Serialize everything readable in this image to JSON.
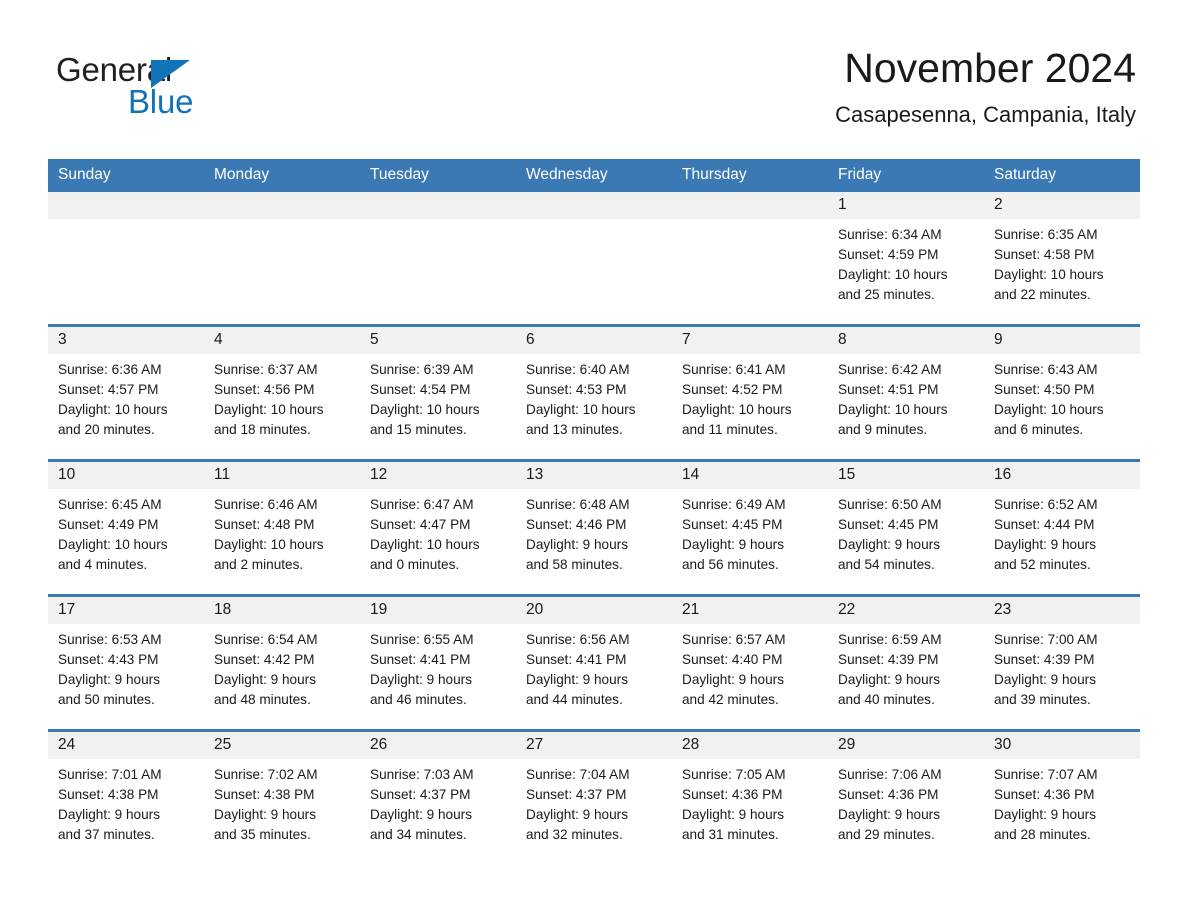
{
  "brand": {
    "name_part1": "General",
    "name_part2": "Blue",
    "accent_color": "#1273b8",
    "logo_icon": "triangle-flag-icon"
  },
  "header": {
    "month_title": "November 2024",
    "location": "Casapesenna, Campania, Italy"
  },
  "calendar": {
    "header_bg": "#3b79b4",
    "daynum_bg": "#f1f1f1",
    "weekdays": [
      "Sunday",
      "Monday",
      "Tuesday",
      "Wednesday",
      "Thursday",
      "Friday",
      "Saturday"
    ],
    "weeks": [
      [
        {
          "day": "",
          "sunrise": "",
          "sunset": "",
          "daylight_line1": "",
          "daylight_line2": "",
          "empty": true
        },
        {
          "day": "",
          "sunrise": "",
          "sunset": "",
          "daylight_line1": "",
          "daylight_line2": "",
          "empty": true
        },
        {
          "day": "",
          "sunrise": "",
          "sunset": "",
          "daylight_line1": "",
          "daylight_line2": "",
          "empty": true
        },
        {
          "day": "",
          "sunrise": "",
          "sunset": "",
          "daylight_line1": "",
          "daylight_line2": "",
          "empty": true
        },
        {
          "day": "",
          "sunrise": "",
          "sunset": "",
          "daylight_line1": "",
          "daylight_line2": "",
          "empty": true
        },
        {
          "day": "1",
          "sunrise": "Sunrise: 6:34 AM",
          "sunset": "Sunset: 4:59 PM",
          "daylight_line1": "Daylight: 10 hours",
          "daylight_line2": "and 25 minutes."
        },
        {
          "day": "2",
          "sunrise": "Sunrise: 6:35 AM",
          "sunset": "Sunset: 4:58 PM",
          "daylight_line1": "Daylight: 10 hours",
          "daylight_line2": "and 22 minutes."
        }
      ],
      [
        {
          "day": "3",
          "sunrise": "Sunrise: 6:36 AM",
          "sunset": "Sunset: 4:57 PM",
          "daylight_line1": "Daylight: 10 hours",
          "daylight_line2": "and 20 minutes."
        },
        {
          "day": "4",
          "sunrise": "Sunrise: 6:37 AM",
          "sunset": "Sunset: 4:56 PM",
          "daylight_line1": "Daylight: 10 hours",
          "daylight_line2": "and 18 minutes."
        },
        {
          "day": "5",
          "sunrise": "Sunrise: 6:39 AM",
          "sunset": "Sunset: 4:54 PM",
          "daylight_line1": "Daylight: 10 hours",
          "daylight_line2": "and 15 minutes."
        },
        {
          "day": "6",
          "sunrise": "Sunrise: 6:40 AM",
          "sunset": "Sunset: 4:53 PM",
          "daylight_line1": "Daylight: 10 hours",
          "daylight_line2": "and 13 minutes."
        },
        {
          "day": "7",
          "sunrise": "Sunrise: 6:41 AM",
          "sunset": "Sunset: 4:52 PM",
          "daylight_line1": "Daylight: 10 hours",
          "daylight_line2": "and 11 minutes."
        },
        {
          "day": "8",
          "sunrise": "Sunrise: 6:42 AM",
          "sunset": "Sunset: 4:51 PM",
          "daylight_line1": "Daylight: 10 hours",
          "daylight_line2": "and 9 minutes."
        },
        {
          "day": "9",
          "sunrise": "Sunrise: 6:43 AM",
          "sunset": "Sunset: 4:50 PM",
          "daylight_line1": "Daylight: 10 hours",
          "daylight_line2": "and 6 minutes."
        }
      ],
      [
        {
          "day": "10",
          "sunrise": "Sunrise: 6:45 AM",
          "sunset": "Sunset: 4:49 PM",
          "daylight_line1": "Daylight: 10 hours",
          "daylight_line2": "and 4 minutes."
        },
        {
          "day": "11",
          "sunrise": "Sunrise: 6:46 AM",
          "sunset": "Sunset: 4:48 PM",
          "daylight_line1": "Daylight: 10 hours",
          "daylight_line2": "and 2 minutes."
        },
        {
          "day": "12",
          "sunrise": "Sunrise: 6:47 AM",
          "sunset": "Sunset: 4:47 PM",
          "daylight_line1": "Daylight: 10 hours",
          "daylight_line2": "and 0 minutes."
        },
        {
          "day": "13",
          "sunrise": "Sunrise: 6:48 AM",
          "sunset": "Sunset: 4:46 PM",
          "daylight_line1": "Daylight: 9 hours",
          "daylight_line2": "and 58 minutes."
        },
        {
          "day": "14",
          "sunrise": "Sunrise: 6:49 AM",
          "sunset": "Sunset: 4:45 PM",
          "daylight_line1": "Daylight: 9 hours",
          "daylight_line2": "and 56 minutes."
        },
        {
          "day": "15",
          "sunrise": "Sunrise: 6:50 AM",
          "sunset": "Sunset: 4:45 PM",
          "daylight_line1": "Daylight: 9 hours",
          "daylight_line2": "and 54 minutes."
        },
        {
          "day": "16",
          "sunrise": "Sunrise: 6:52 AM",
          "sunset": "Sunset: 4:44 PM",
          "daylight_line1": "Daylight: 9 hours",
          "daylight_line2": "and 52 minutes."
        }
      ],
      [
        {
          "day": "17",
          "sunrise": "Sunrise: 6:53 AM",
          "sunset": "Sunset: 4:43 PM",
          "daylight_line1": "Daylight: 9 hours",
          "daylight_line2": "and 50 minutes."
        },
        {
          "day": "18",
          "sunrise": "Sunrise: 6:54 AM",
          "sunset": "Sunset: 4:42 PM",
          "daylight_line1": "Daylight: 9 hours",
          "daylight_line2": "and 48 minutes."
        },
        {
          "day": "19",
          "sunrise": "Sunrise: 6:55 AM",
          "sunset": "Sunset: 4:41 PM",
          "daylight_line1": "Daylight: 9 hours",
          "daylight_line2": "and 46 minutes."
        },
        {
          "day": "20",
          "sunrise": "Sunrise: 6:56 AM",
          "sunset": "Sunset: 4:41 PM",
          "daylight_line1": "Daylight: 9 hours",
          "daylight_line2": "and 44 minutes."
        },
        {
          "day": "21",
          "sunrise": "Sunrise: 6:57 AM",
          "sunset": "Sunset: 4:40 PM",
          "daylight_line1": "Daylight: 9 hours",
          "daylight_line2": "and 42 minutes."
        },
        {
          "day": "22",
          "sunrise": "Sunrise: 6:59 AM",
          "sunset": "Sunset: 4:39 PM",
          "daylight_line1": "Daylight: 9 hours",
          "daylight_line2": "and 40 minutes."
        },
        {
          "day": "23",
          "sunrise": "Sunrise: 7:00 AM",
          "sunset": "Sunset: 4:39 PM",
          "daylight_line1": "Daylight: 9 hours",
          "daylight_line2": "and 39 minutes."
        }
      ],
      [
        {
          "day": "24",
          "sunrise": "Sunrise: 7:01 AM",
          "sunset": "Sunset: 4:38 PM",
          "daylight_line1": "Daylight: 9 hours",
          "daylight_line2": "and 37 minutes."
        },
        {
          "day": "25",
          "sunrise": "Sunrise: 7:02 AM",
          "sunset": "Sunset: 4:38 PM",
          "daylight_line1": "Daylight: 9 hours",
          "daylight_line2": "and 35 minutes."
        },
        {
          "day": "26",
          "sunrise": "Sunrise: 7:03 AM",
          "sunset": "Sunset: 4:37 PM",
          "daylight_line1": "Daylight: 9 hours",
          "daylight_line2": "and 34 minutes."
        },
        {
          "day": "27",
          "sunrise": "Sunrise: 7:04 AM",
          "sunset": "Sunset: 4:37 PM",
          "daylight_line1": "Daylight: 9 hours",
          "daylight_line2": "and 32 minutes."
        },
        {
          "day": "28",
          "sunrise": "Sunrise: 7:05 AM",
          "sunset": "Sunset: 4:36 PM",
          "daylight_line1": "Daylight: 9 hours",
          "daylight_line2": "and 31 minutes."
        },
        {
          "day": "29",
          "sunrise": "Sunrise: 7:06 AM",
          "sunset": "Sunset: 4:36 PM",
          "daylight_line1": "Daylight: 9 hours",
          "daylight_line2": "and 29 minutes."
        },
        {
          "day": "30",
          "sunrise": "Sunrise: 7:07 AM",
          "sunset": "Sunset: 4:36 PM",
          "daylight_line1": "Daylight: 9 hours",
          "daylight_line2": "and 28 minutes."
        }
      ]
    ]
  }
}
